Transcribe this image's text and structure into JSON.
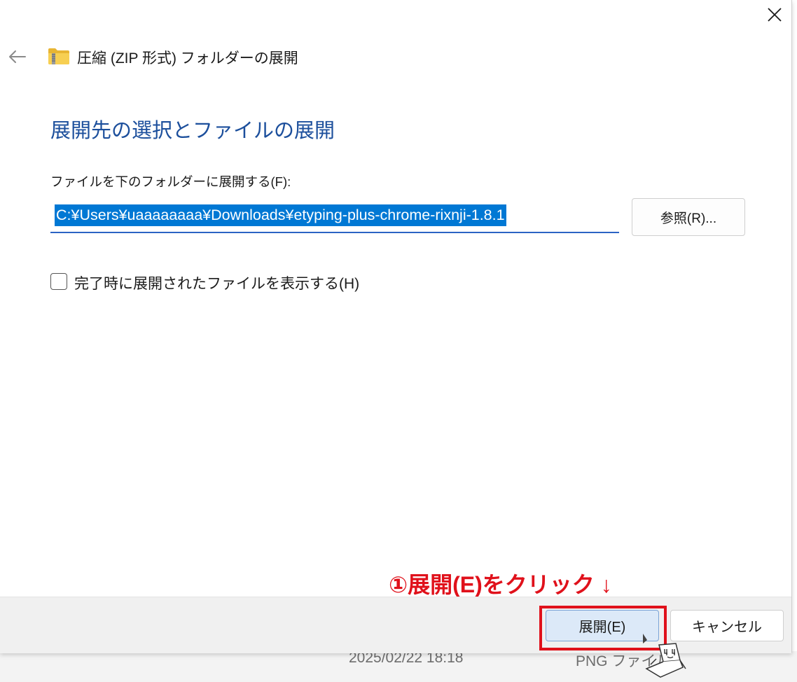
{
  "window": {
    "title": "圧縮 (ZIP 形式) フォルダーの展開",
    "back_icon": "back-arrow-icon",
    "close_icon": "close-icon",
    "folder_icon": "zip-folder-icon"
  },
  "main": {
    "heading": "展開先の選択とファイルの展開",
    "path_label": "ファイルを下のフォルダーに展開する(F):",
    "path_value": "C:¥Users¥uaaaaaaaa¥Downloads¥etyping-plus-chrome-rixnji-1.8.1",
    "browse_label": "参照(R)...",
    "checkbox_label": "完了時に展開されたファイルを表示する(H)",
    "checkbox_checked": false
  },
  "annotation": {
    "text": "①展開(E)をクリック ↓",
    "color": "#e0111b"
  },
  "footer": {
    "extract_label": "展開(E)",
    "cancel_label": "キャンセル"
  },
  "background": {
    "date_text": "2025/02/22 18:18",
    "type_text": "PNG ファイル"
  },
  "colors": {
    "heading": "#1c4f9c",
    "selection": "#0078d4",
    "accent_border": "#2b63c4"
  }
}
